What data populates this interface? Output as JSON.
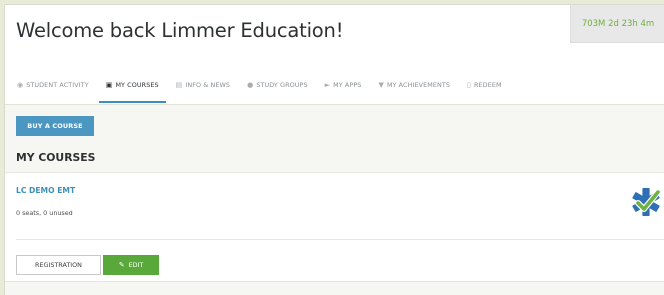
{
  "header": {
    "welcome": "Welcome back Limmer Education!",
    "timer": "703M 2d 23h 4m"
  },
  "tabs": [
    {
      "label": "STUDENT ACTIVITY",
      "icon": "dashboard-icon",
      "active": false
    },
    {
      "label": "MY COURSES",
      "icon": "briefcase-icon",
      "active": true
    },
    {
      "label": "INFO & NEWS",
      "icon": "newspaper-icon",
      "active": false
    },
    {
      "label": "STUDY GROUPS",
      "icon": "chat-icon",
      "active": false
    },
    {
      "label": "MY APPS",
      "icon": "tag-icon",
      "active": false
    },
    {
      "label": "MY ACHIEVEMENTS",
      "icon": "shield-icon",
      "active": false
    },
    {
      "label": "REDEEM",
      "icon": "barcode-icon",
      "active": false
    }
  ],
  "buy_button": "BUY A COURSE",
  "section_title": "MY COURSES",
  "course": {
    "name": "LC DEMO EMT",
    "seats": "0 seats, 0 unused",
    "registration_label": "REGISTRATION",
    "edit_label": "EDIT",
    "logo_icon": "star-of-life-check-icon"
  },
  "colors": {
    "accent": "#3d8fb8",
    "buy_button": "#4c97c2",
    "edit_button": "#58a83a",
    "timer_text": "#6fae42"
  }
}
